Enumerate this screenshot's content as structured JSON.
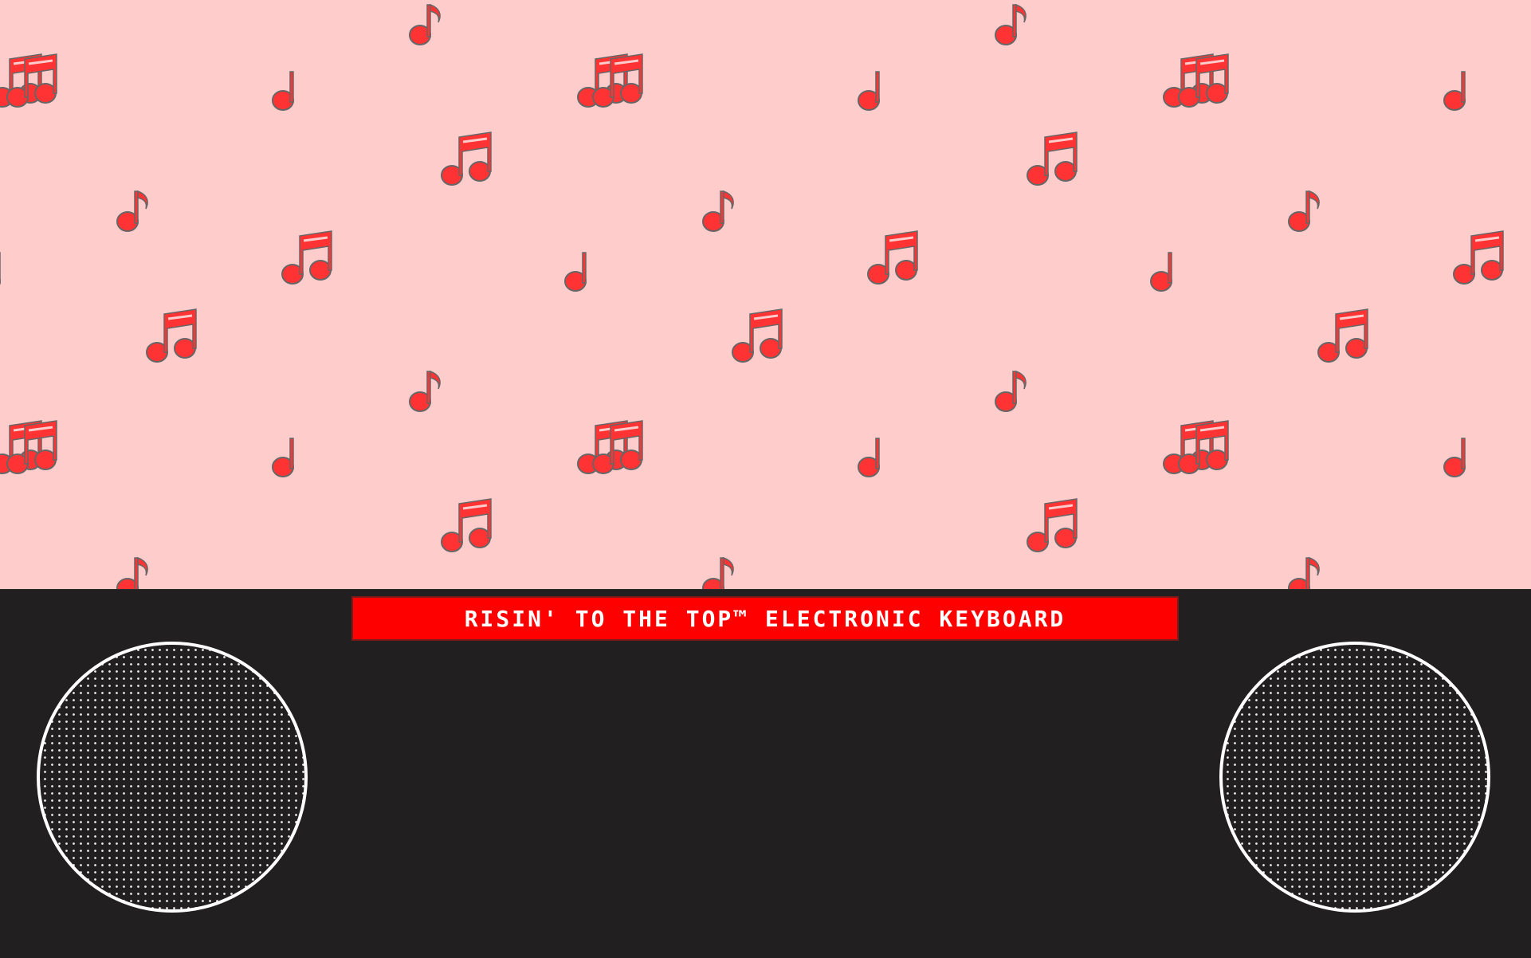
{
  "title_plate": {
    "label": "RISIN' TO THE TOP™ ELECTRONIC KEYBOARD"
  },
  "colors": {
    "wallpaper_background": "#ffcccc",
    "note_fill": "#ff3333",
    "note_outline": "#666666",
    "keyboard_body": "#221f20",
    "title_plate": "#ff0000",
    "title_text": "#ffffff",
    "speaker_ring": "#ffffff"
  },
  "icons": {
    "wallpaper_notes": [
      "beamed-sixteenth-notes-icon",
      "quarter-note-icon",
      "eighth-note-icon"
    ],
    "speakers": [
      "speaker-grille-left",
      "speaker-grille-right"
    ]
  }
}
